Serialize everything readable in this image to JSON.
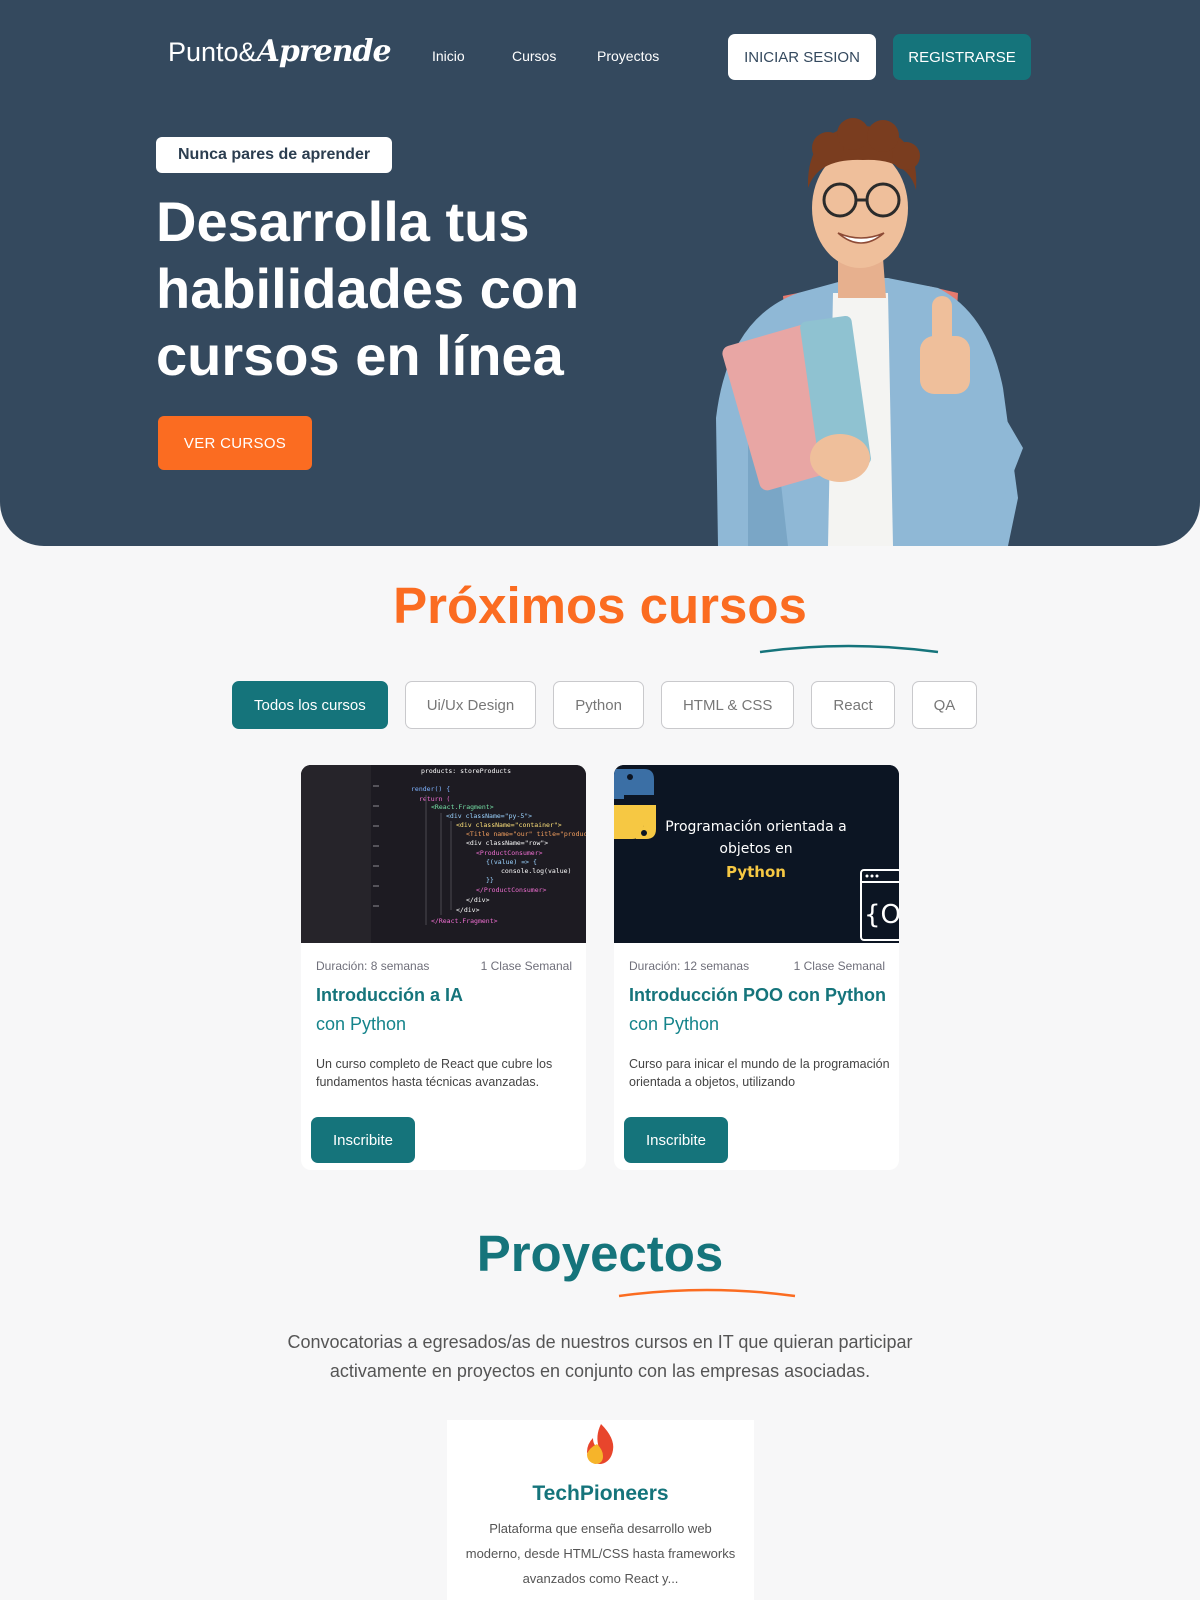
{
  "brand": {
    "logo_text_1": "Punto&",
    "logo_text_2": "Aprende"
  },
  "nav": {
    "items": [
      "Inicio",
      "Cursos",
      "Proyectos"
    ],
    "login_label": "INICIAR SESION",
    "register_label": "REGISTRARSE"
  },
  "hero": {
    "tagline": "Nunca pares de aprender",
    "title_lines": [
      "Desarrolla tus",
      "habilidades con",
      "cursos en línea"
    ],
    "cta_label": "VER CURSOS"
  },
  "courses_section": {
    "title": "Próximos cursos",
    "filters": [
      "Todos los cursos",
      "Ui/Ux Design",
      "Python",
      "HTML & CSS",
      "React",
      "QA"
    ],
    "active_filter": "Todos los cursos",
    "cards": [
      {
        "duration": "Duración: 8 semanas",
        "frequency": "1 Clase Semanal",
        "title": "Introducción a IA",
        "subtitle": "con Python",
        "description": "Un curso completo de React que cubre los fundamentos hasta técnicas avanzadas.",
        "button": "Inscribite",
        "image_code_lines": [
          "products: storeProducts",
          "render() {",
          "return (",
          "<React.Fragment>",
          "<div className=\"py-5\">",
          "<div className=\"container\">",
          "<Title name=\"our\" title=\"product",
          "<div className=\"row\">",
          "<ProductConsumer>",
          "{(value) => {",
          "console.log(value)",
          "}}",
          "</ProductConsumer>",
          "</div>",
          "</div>",
          "</React.Fragment>"
        ]
      },
      {
        "duration": "Duración: 12 semanas",
        "frequency": "1 Clase Semanal",
        "title": "Introducción POO con Python",
        "subtitle": "con Python",
        "description": "Curso para inicar el mundo de la programación orientada a objetos, utilizando",
        "button": "Inscribite",
        "image_text_1": "Programación orientada a",
        "image_text_2": "objetos en",
        "image_text_3": "Python",
        "image_badge": "{OO"
      }
    ]
  },
  "projects_section": {
    "title": "Proyectos",
    "description": "Convocatorias a egresados/as de nuestros cursos en IT que quieran participar activamente en proyectos en conjunto con las empresas asociadas.",
    "cards": [
      {
        "name": "TechPioneers",
        "description": "Plataforma que enseña desarrollo web moderno, desde HTML/CSS hasta frameworks avanzados como React y..."
      }
    ]
  },
  "colors": {
    "navy": "#34495e",
    "teal": "#15747b",
    "orange": "#fb6c21",
    "background": "#f7f7f8"
  }
}
